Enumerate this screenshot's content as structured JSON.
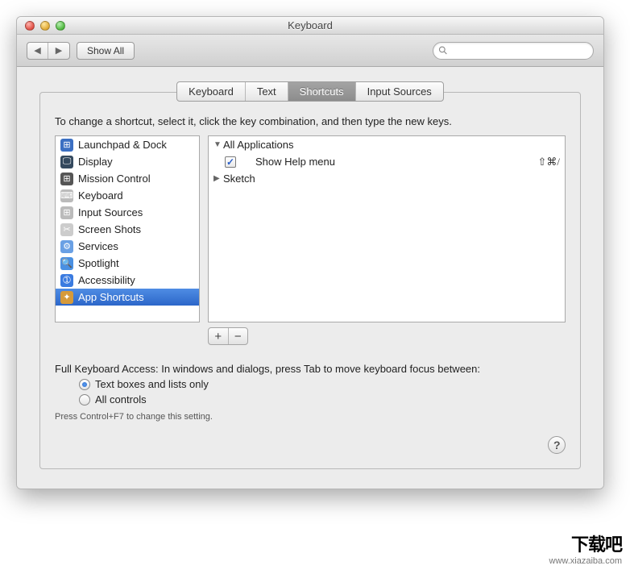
{
  "window": {
    "title": "Keyboard"
  },
  "toolbar": {
    "show_all": "Show All"
  },
  "tabs": [
    "Keyboard",
    "Text",
    "Shortcuts",
    "Input Sources"
  ],
  "active_tab_index": 2,
  "instruction": "To change a shortcut, select it, click the key combination, and then type the new keys.",
  "categories": [
    {
      "label": "Launchpad & Dock",
      "icon_bg": "#3b6fc2",
      "icon_glyph": "⊞"
    },
    {
      "label": "Display",
      "icon_bg": "#34495e",
      "icon_glyph": "🖵"
    },
    {
      "label": "Mission Control",
      "icon_bg": "#555",
      "icon_glyph": "⊞"
    },
    {
      "label": "Keyboard",
      "icon_bg": "#bbb",
      "icon_glyph": "⌨"
    },
    {
      "label": "Input Sources",
      "icon_bg": "#bbb",
      "icon_glyph": "⊞"
    },
    {
      "label": "Screen Shots",
      "icon_bg": "#ccc",
      "icon_glyph": "✂"
    },
    {
      "label": "Services",
      "icon_bg": "#6aa0e4",
      "icon_glyph": "⚙"
    },
    {
      "label": "Spotlight",
      "icon_bg": "#4a90e2",
      "icon_glyph": "🔍"
    },
    {
      "label": "Accessibility",
      "icon_bg": "#3a7be0",
      "icon_glyph": "➀"
    },
    {
      "label": "App Shortcuts",
      "icon_bg": "#d69a3a",
      "icon_glyph": "✦",
      "selected": true
    }
  ],
  "tree": {
    "group1": "All Applications",
    "item1_label": "Show Help menu",
    "item1_key": "⇧⌘/",
    "group2": "Sketch"
  },
  "full_keyboard_access": {
    "text": "Full Keyboard Access: In windows and dialogs, press Tab to move keyboard focus between:",
    "opt1": "Text boxes and lists only",
    "opt2": "All controls",
    "hint": "Press Control+F7 to change this setting."
  },
  "watermark": {
    "logo": "下载吧",
    "url": "www.xiazaiba.com"
  }
}
